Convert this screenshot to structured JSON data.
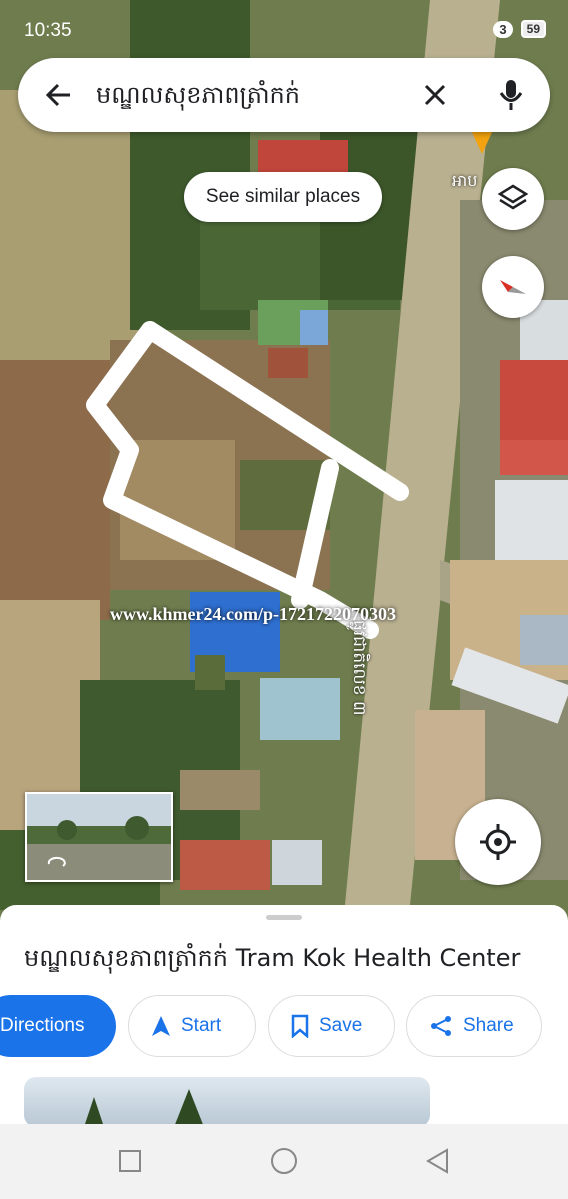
{
  "status_bar": {
    "time": "10:35",
    "notif_count": "3",
    "battery": "59"
  },
  "search": {
    "query": "មណ្ឌលសុខភាពត្រាំកក់"
  },
  "map": {
    "chip_label": "See similar places",
    "poi_label": "អាប",
    "road_label": "ផ្លូវជាតិលេខ ៣",
    "watermark": "www.khmer24.com/p-1721722070303"
  },
  "place": {
    "title": "មណ្ឌលសុខភាពត្រាំកក់ Tram Kok Health Center",
    "actions": {
      "directions": "Directions",
      "start": "Start",
      "save": "Save",
      "share": "Share"
    }
  },
  "colors": {
    "accent": "#1a73e8",
    "road": "#b9b090",
    "field": "#8a7a55"
  },
  "icons": [
    "back-arrow-icon",
    "close-icon",
    "mic-icon",
    "layers-icon",
    "compass-icon",
    "my-location-icon",
    "navigation-arrow-icon",
    "bookmark-icon",
    "share-icon",
    "recent-apps-icon",
    "home-icon",
    "back-icon"
  ]
}
